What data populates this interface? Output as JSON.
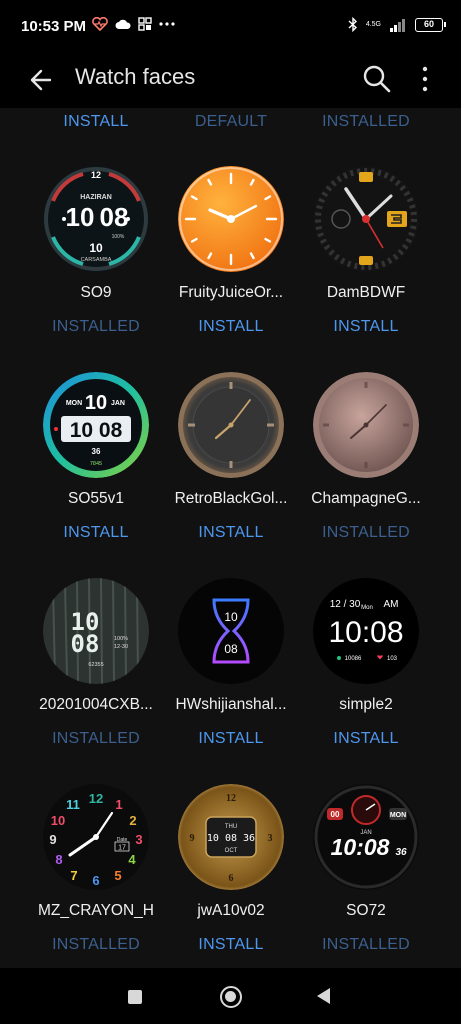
{
  "status_bar": {
    "time": "10:53 PM",
    "network": "4.5G",
    "battery": "60",
    "icons": [
      "heart-rate-icon",
      "cloud-icon",
      "app-grid-icon",
      "more-dots-icon",
      "bluetooth-icon",
      "signal-icon",
      "battery-icon"
    ]
  },
  "app_bar": {
    "title": "Watch faces",
    "icons": [
      "back-arrow-icon",
      "search-icon",
      "overflow-menu-icon"
    ]
  },
  "top_row_actions": [
    "INSTALL",
    "DEFAULT",
    "INSTALLED"
  ],
  "watch_faces": [
    {
      "name": "SO9",
      "action": "INSTALLED"
    },
    {
      "name": "FruityJuiceOr...",
      "action": "INSTALL"
    },
    {
      "name": "DamBDWF",
      "action": "INSTALL"
    },
    {
      "name": "SO55v1",
      "action": "INSTALL"
    },
    {
      "name": "RetroBlackGol...",
      "action": "INSTALL"
    },
    {
      "name": "ChampagneG...",
      "action": "INSTALLED"
    },
    {
      "name": "20201004CXB...",
      "action": "INSTALLED"
    },
    {
      "name": "HWshijianshal...",
      "action": "INSTALL"
    },
    {
      "name": "simple2",
      "action": "INSTALL"
    },
    {
      "name": "MZ_CRAYON_H",
      "action": "INSTALLED"
    },
    {
      "name": "jwA10v02",
      "action": "INSTALL"
    },
    {
      "name": "SO72",
      "action": "INSTALLED"
    }
  ],
  "face_text": {
    "so9": {
      "day": "HAZIRAN",
      "hour": "10",
      "minute": "08",
      "date": "10",
      "weekday": "CARSAMBA",
      "battery": "100%"
    },
    "so55": {
      "day": "MON",
      "date": "10",
      "month": "JAN",
      "time": "10 08",
      "num": "36",
      "steps": "7845"
    },
    "cxb": {
      "hour": "10",
      "minute": "08",
      "battery": "100%",
      "date": "12-30",
      "steps": "62355"
    },
    "hws": {
      "hour": "10",
      "minute": "08"
    },
    "simple2": {
      "date": "12 / 30",
      "weekday": "Mon",
      "ampm": "AM",
      "time": "10:08",
      "steps": "10086",
      "heart": "103"
    },
    "crayon": {
      "date_label": "Date",
      "date": "17"
    },
    "jwa": {
      "day": "THU",
      "time": "10 08 36",
      "month": "OCT"
    },
    "so72": {
      "left": "00",
      "right": "MON",
      "month": "JAN",
      "time": "10:08",
      "seconds": "36"
    }
  },
  "colors": {
    "install": "#4d97ef",
    "installed": "#3b5f8e",
    "background": "#111111"
  }
}
